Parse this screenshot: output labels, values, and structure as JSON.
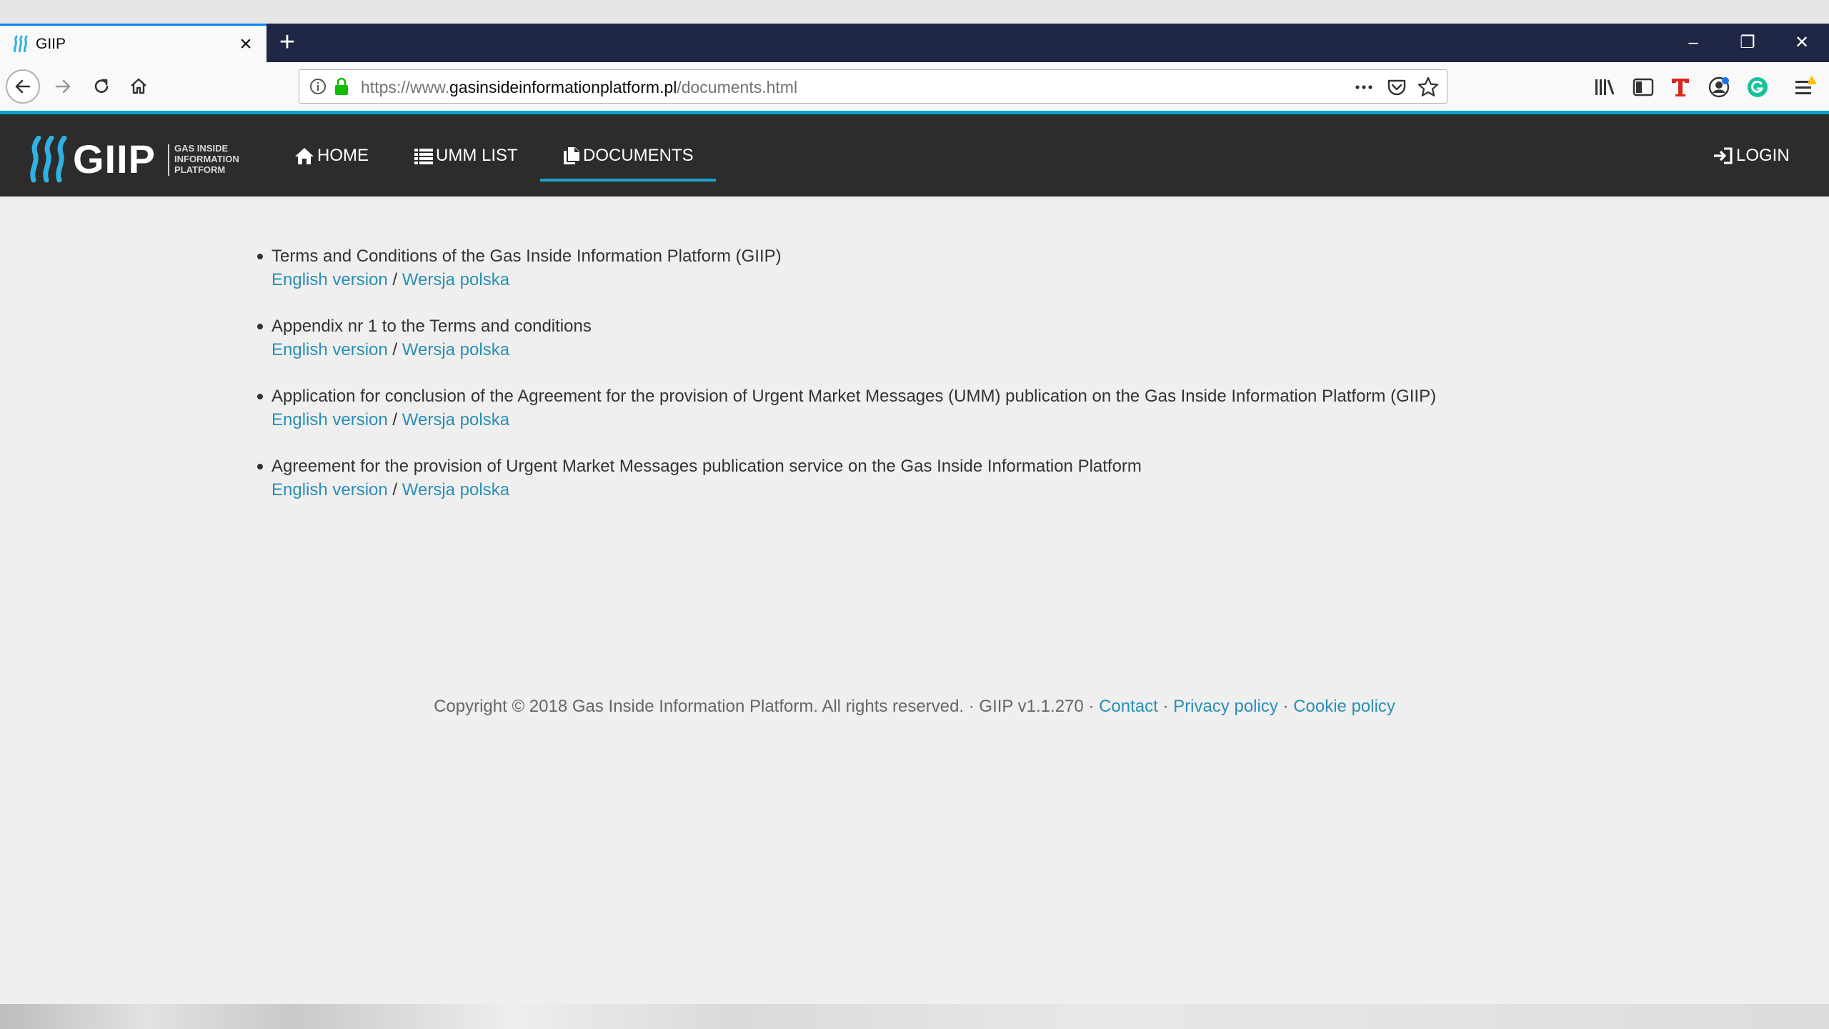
{
  "browser": {
    "tab_title": "GIIP",
    "url_prefix": "https://www.",
    "url_domain": "gasinsideinformationplatform.pl",
    "url_path": "/documents.html",
    "accent_color": "#0a84ff"
  },
  "site": {
    "logo_text": "GIIP",
    "logo_sub": "GAS INSIDE INFORMATION PLATFORM",
    "nav": {
      "home": "HOME",
      "umm_list": "UMM LIST",
      "documents": "DOCUMENTS",
      "login": "LOGIN"
    },
    "header_color": "#2e2c2b",
    "link_color": "#2a8fb4"
  },
  "documents": [
    {
      "title": "Terms and Conditions of the Gas Inside Information Platform (GIIP)",
      "english": "English version",
      "separator": "/",
      "polish": "Wersja polska"
    },
    {
      "title": "Appendix nr 1 to the Terms and conditions",
      "english": "English version",
      "separator": "/",
      "polish": "Wersja polska"
    },
    {
      "title": "Application for conclusion of the Agreement for the provision of Urgent Market Messages (UMM) publication on the Gas Inside Information Platform (GIIP)",
      "english": "English version",
      "separator": "/",
      "polish": "Wersja polska"
    },
    {
      "title": "Agreement for the provision of Urgent Market Messages publication service on the Gas Inside Information Platform",
      "english": "English version",
      "separator": "/",
      "polish": "Wersja polska"
    }
  ],
  "footer": {
    "copyright": "Copyright © 2018 Gas Inside Information Platform. All rights reserved. · GIIP v1.1.270 ·",
    "contact": "Contact",
    "dot1": "·",
    "privacy": "Privacy policy",
    "dot2": "·",
    "cookie": "Cookie policy"
  }
}
